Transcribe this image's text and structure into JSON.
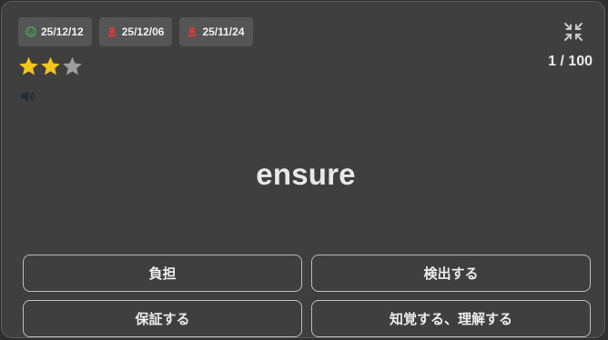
{
  "badges": [
    {
      "icon": "smile-icon",
      "color": "#4caf50",
      "date": "25/12/12"
    },
    {
      "icon": "skull-icon",
      "color": "#e53935",
      "date": "25/12/06"
    },
    {
      "icon": "skull-icon",
      "color": "#e53935",
      "date": "25/11/24"
    }
  ],
  "rating": {
    "filled": 2,
    "total": 3,
    "filled_color": "#f5c518",
    "empty_color": "#9e9e9e"
  },
  "audio": {
    "icon": "speaker-icon"
  },
  "collapse": {
    "icon": "collapse-icon"
  },
  "counter": "1 / 100",
  "word": "ensure",
  "choices": [
    "負担",
    "検出する",
    "保証する",
    "知覚する、理解する"
  ]
}
